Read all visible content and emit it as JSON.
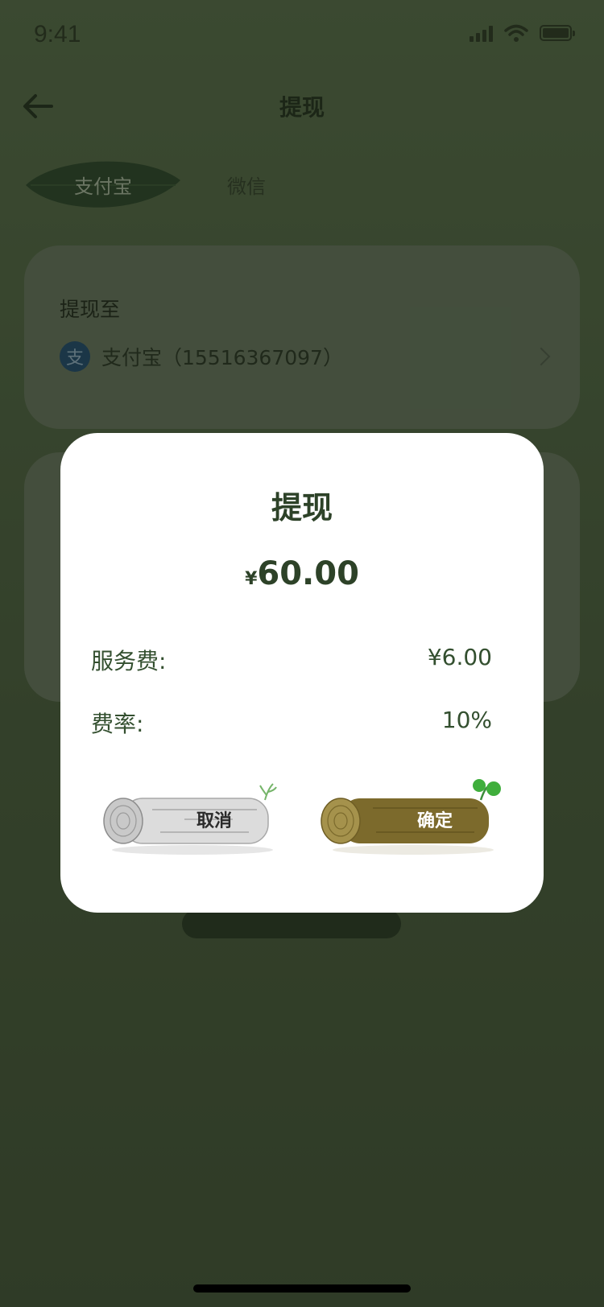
{
  "status_bar": {
    "time": "9:41"
  },
  "nav": {
    "title": "提现"
  },
  "tabs": [
    {
      "label": "支付宝",
      "active": true
    },
    {
      "label": "微信",
      "active": false
    }
  ],
  "account_card": {
    "title": "提现至",
    "account": "支付宝（15516367097）",
    "icon": "alipay-icon"
  },
  "dialog": {
    "title": "提现",
    "currency": "¥",
    "amount": "60.00",
    "service_fee_label": "服务费:",
    "service_fee_value": "¥6.00",
    "rate_label": "费率:",
    "rate_value": "10%",
    "cancel_label": "取消",
    "confirm_label": "确定"
  },
  "colors": {
    "background": "#556b46",
    "primary_text": "#2d4228",
    "dialog_bg": "#ffffff"
  }
}
